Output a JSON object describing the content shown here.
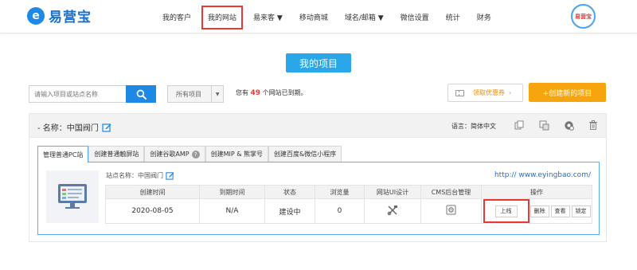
{
  "brand": {
    "name": "易营宝",
    "mark": "e"
  },
  "nav": [
    {
      "label": "我的客户"
    },
    {
      "label": "我的网站",
      "active": true
    },
    {
      "label": "易来客 ▼"
    },
    {
      "label": "移动商城"
    },
    {
      "label": "域名/邮箱 ▼"
    },
    {
      "label": "微信设置"
    },
    {
      "label": "统计"
    },
    {
      "label": "财务"
    }
  ],
  "avatar": {
    "label": "易营宝"
  },
  "page": {
    "title": "我的项目"
  },
  "search": {
    "placeholder": "请输入项目或站点名称"
  },
  "filter": {
    "selected": "所有项目"
  },
  "expire": {
    "prefix": "您有",
    "count": "49",
    "suffix": "个网站已到期。"
  },
  "actions": {
    "coupon": "领取优惠券",
    "create": "+创建新的项目"
  },
  "project": {
    "name": "- 名称：中国阀门",
    "language": "语言：简体中文",
    "tabs": [
      {
        "label": "管理普通PC站"
      },
      {
        "label": "创建普通触屏站"
      },
      {
        "label": "创建谷歌AMP"
      },
      {
        "label": "创建MIP & 熊掌号"
      },
      {
        "label": "创建百度&微信小程序"
      }
    ],
    "site": {
      "label": "站点名称：中国阀门",
      "url": "http:// www.eyingbao.com/",
      "columns": [
        "创建时间",
        "到期时间",
        "状态",
        "浏览量",
        "网站UI设计",
        "CMS后台管理",
        "操作"
      ],
      "row": {
        "created": "2020-08-05",
        "expires": "N/A",
        "status": "建设中",
        "views": "0"
      },
      "ops": {
        "online": "上线",
        "delete": "删除",
        "view": "查看",
        "lock": "锁定"
      }
    }
  },
  "colors": {
    "primary": "#1e88e5",
    "accent": "#f7a50f",
    "highlight": "#e53935"
  }
}
